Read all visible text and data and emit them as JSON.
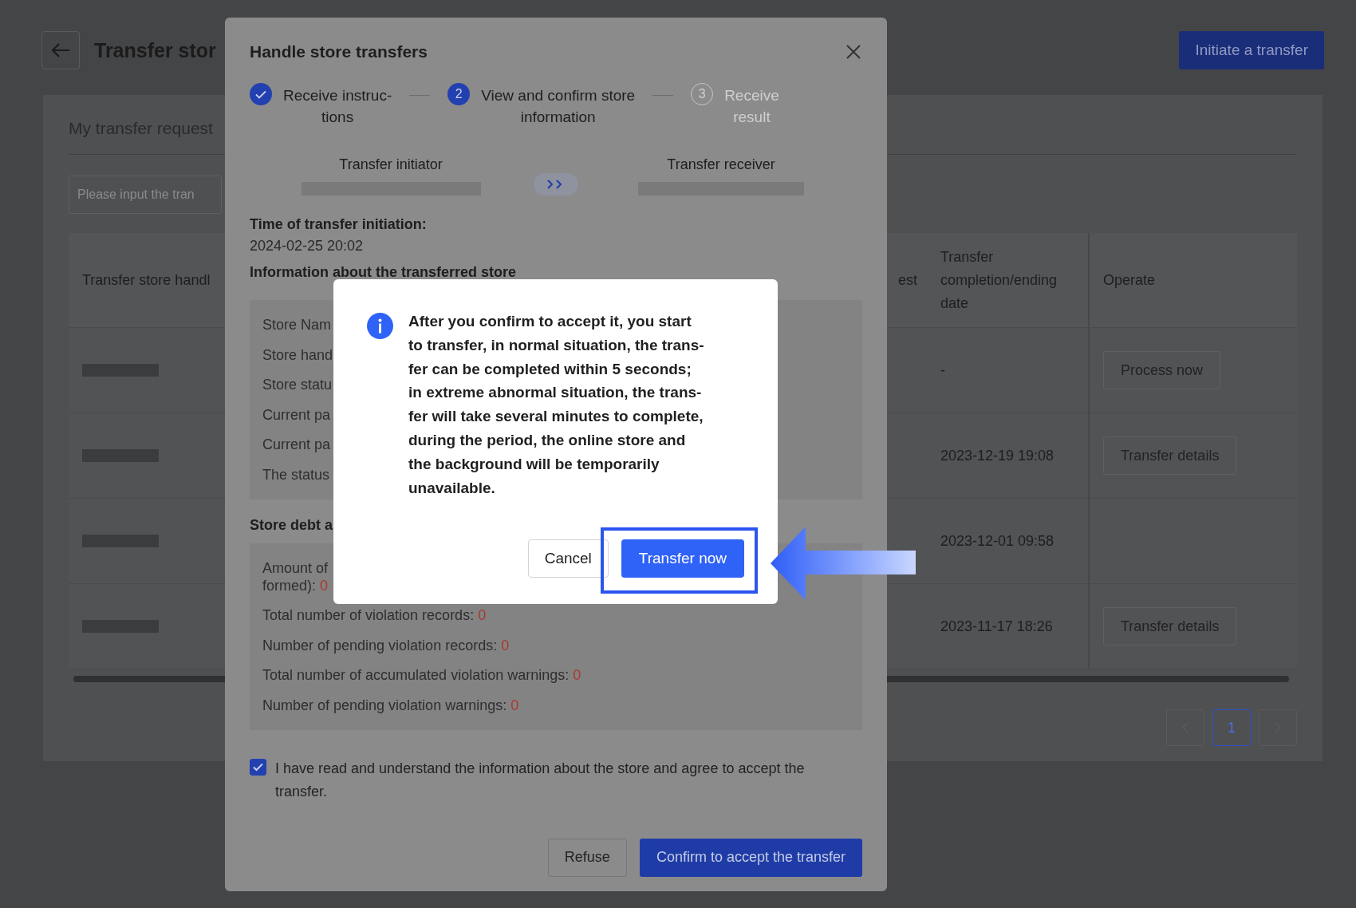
{
  "page": {
    "title": "Transfer stor",
    "initiate_button": "Initiate a transfer",
    "section_title": "My transfer request",
    "search": {
      "placeholder": "Please input the tran"
    },
    "table": {
      "columns": [
        "Transfer store handl",
        "est",
        "Transfer completion/ending date",
        "Operate"
      ],
      "rows": [
        {
          "date": "-",
          "action": "Process now"
        },
        {
          "date": "2023-12-19 19:08",
          "action": "Transfer details"
        },
        {
          "date": "2023-12-01 09:58"
        },
        {
          "date": "2023-11-17 18:26",
          "action": "Transfer details"
        }
      ]
    },
    "pagination": [
      {
        "label": "1",
        "selected": true
      }
    ]
  },
  "modal": {
    "title": "Handle store transfers",
    "steps": [
      {
        "label": "Receive instruc-\ntions",
        "kind": "done"
      },
      {
        "number": "2",
        "label": "View and confirm store\ninformation",
        "kind": "current"
      },
      {
        "number": "3",
        "label": "Receive\nresult",
        "kind": "waiting"
      }
    ],
    "initiator_label": "Transfer initiator",
    "receiver_label": "Transfer receiver",
    "time_label": "Time of transfer initiation:",
    "time_value": "2024-02-25 20:02",
    "info_heading": "Information about the transferred store",
    "info_rows": [
      "Store Nam",
      "Store hand",
      "Store statu",
      "Current pa",
      "Current pa",
      "The status"
    ],
    "debt_heading": "Store debt a",
    "debt_rows": [
      {
        "label": "Amount of\nformed):",
        "value": "0"
      },
      {
        "label": "Total number of violation records:",
        "value": "0"
      },
      {
        "label": "Number of pending violation records:",
        "value": "0"
      },
      {
        "label": "Total number of accumulated violation warnings:",
        "value": "0"
      },
      {
        "label": "Number of pending violation warnings:",
        "value": "0"
      }
    ],
    "agreement": {
      "checked": true,
      "text": "I have read and understand the information about the store and agree to accept the transfer."
    },
    "refuse_button": "Refuse",
    "confirm_button": "Confirm to accept the transfer"
  },
  "dialog": {
    "message": "After you confirm to accept it, you start\nto transfer, in normal situation, the trans-\nfer can be completed within 5 seconds;\nin extreme abnormal situation, the trans-\nfer will take several minutes to complete,\nduring the period, the online store and\nthe background will be temporarily\nunavailable.",
    "cancel_button": "Cancel",
    "confirm_button": "Transfer now",
    "highlighted": true
  }
}
